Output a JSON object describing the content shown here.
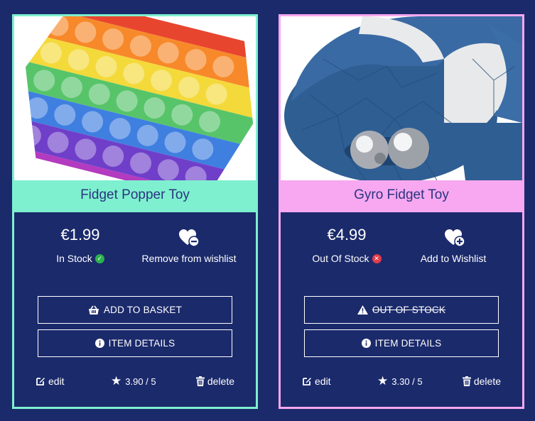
{
  "colors": {
    "page_bg": "#1b2a6b",
    "card1_accent": "#7ef0cf",
    "card2_accent": "#f7a8f0",
    "in_stock": "#2bb24c",
    "out_of_stock": "#e23b4a"
  },
  "products": [
    {
      "title": "Fidget Popper Toy",
      "price": "€1.99",
      "stock": "In Stock",
      "stock_icon": "check-circle-icon",
      "wishlist_label": "Remove from wishlist",
      "wishlist_icon": "heart-minus-icon",
      "primary_button": "ADD TO BASKET",
      "primary_icon": "basket-icon",
      "details_button": "ITEM DETAILS",
      "edit_label": "edit",
      "rating": "3.90 / 5",
      "delete_label": "delete"
    },
    {
      "title": "Gyro Fidget Toy",
      "price": "€4.99",
      "stock": "Out Of Stock",
      "stock_icon": "x-circle-icon",
      "wishlist_label": "Add to Wishlist",
      "wishlist_icon": "heart-plus-icon",
      "primary_button": "OUT OF STOCK",
      "primary_icon": "warning-icon",
      "details_button": "ITEM DETAILS",
      "edit_label": "edit",
      "rating": "3.30 / 5",
      "delete_label": "delete"
    }
  ]
}
